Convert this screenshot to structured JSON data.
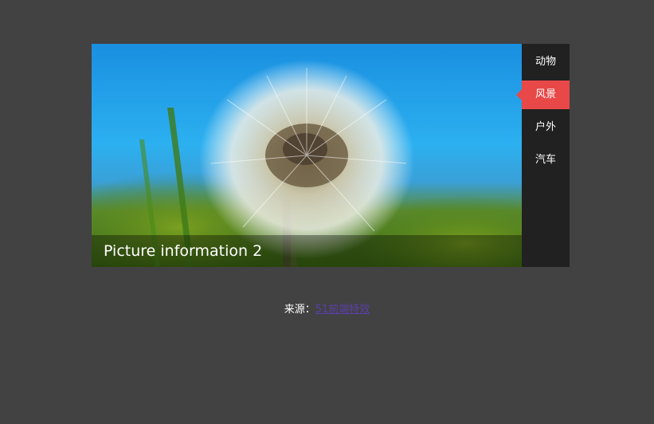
{
  "slider": {
    "caption": "Picture information 2",
    "menu": [
      {
        "label": "动物",
        "active": false
      },
      {
        "label": "风景",
        "active": true
      },
      {
        "label": "户外",
        "active": false
      },
      {
        "label": "汽车",
        "active": false
      }
    ],
    "accent_color": "#e84848",
    "menu_bg_color": "#212121"
  },
  "image": {
    "icon": "dandelion-photo"
  },
  "footer": {
    "source_label": "来源：",
    "source_link": "51前端特效"
  }
}
